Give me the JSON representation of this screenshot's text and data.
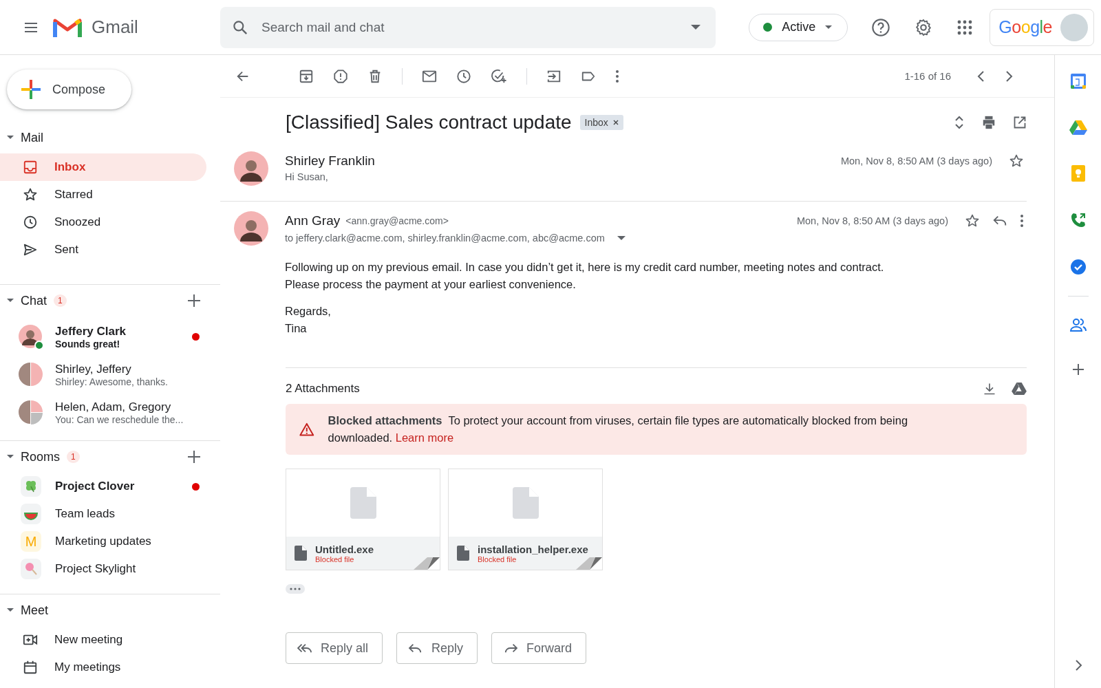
{
  "header": {
    "app_name": "Gmail",
    "search": {
      "placeholder": "Search mail and chat"
    },
    "status": {
      "label": "Active"
    },
    "account": {
      "brand": "Google"
    }
  },
  "sidebar": {
    "compose": "Compose",
    "mail": {
      "title": "Mail",
      "expanded": true,
      "items": [
        {
          "label": "Inbox",
          "kind": "inbox",
          "selected": true
        },
        {
          "label": "Starred",
          "kind": "star",
          "selected": false
        },
        {
          "label": "Snoozed",
          "kind": "clock",
          "selected": false
        },
        {
          "label": "Sent",
          "kind": "send",
          "selected": false
        }
      ]
    },
    "chat": {
      "title": "Chat",
      "badge": "1",
      "expanded": true,
      "items": [
        {
          "name": "Jeffery Clark",
          "preview": "Sounds great!",
          "kind": "single",
          "unread": true,
          "online": true
        },
        {
          "name": "Shirley, Jeffery",
          "preview": "Shirley: Awesome, thanks.",
          "kind": "pair",
          "unread": false,
          "online": false
        },
        {
          "name": "Helen, Adam, Gregory",
          "preview": "You: Can we reschedule the...",
          "kind": "group",
          "unread": false,
          "online": false
        }
      ]
    },
    "rooms": {
      "title": "Rooms",
      "badge": "1",
      "expanded": true,
      "items": [
        {
          "name": "Project Clover",
          "kind": "clover",
          "unread": true
        },
        {
          "name": "Team leads",
          "kind": "melon",
          "unread": false
        },
        {
          "name": "Marketing updates",
          "kind": "letter",
          "letter": "M",
          "unread": false
        },
        {
          "name": "Project Skylight",
          "kind": "lollipop",
          "unread": false
        }
      ]
    },
    "meet": {
      "title": "Meet",
      "expanded": true,
      "items": [
        {
          "label": "New meeting",
          "kind": "video"
        },
        {
          "label": "My meetings",
          "kind": "calendar"
        }
      ]
    }
  },
  "toolbar": {
    "pagination": "1-16 of 16"
  },
  "thread": {
    "subject": "[Classified] Sales contract update",
    "label": "Inbox",
    "messages": [
      {
        "sender": "Shirley Franklin",
        "snippet": "Hi Susan,",
        "date": "Mon, Nov 8, 8:50 AM (3 days ago)",
        "expanded": false,
        "starred": false
      },
      {
        "sender": "Ann Gray",
        "email": "<ann.gray@acme.com>",
        "to": "to jeffery.clark@acme.com, shirley.franklin@acme.com, abc@acme.com",
        "date": "Mon, Nov 8, 8:50 AM (3 days ago)",
        "expanded": true,
        "starred": false,
        "body": [
          "Following up on my previous email. In case you didn’t get it, here is my credit card number, meeting notes and contract.\nPlease process the payment at your earliest convenience.",
          "Regards,\nTina"
        ]
      }
    ],
    "attachments": {
      "title": "2 Attachments",
      "warning": {
        "title": "Blocked attachments",
        "text": "To protect your account from viruses, certain file types are automatically blocked from being downloaded.",
        "link": "Learn more"
      },
      "files": [
        {
          "name": "Untitled.exe",
          "status": "Blocked file"
        },
        {
          "name": "installation_helper.exe",
          "status": "Blocked file"
        }
      ]
    },
    "actions": [
      {
        "label": "Reply all",
        "kind": "reply_all"
      },
      {
        "label": "Reply",
        "kind": "reply"
      },
      {
        "label": "Forward",
        "kind": "forward"
      }
    ]
  }
}
